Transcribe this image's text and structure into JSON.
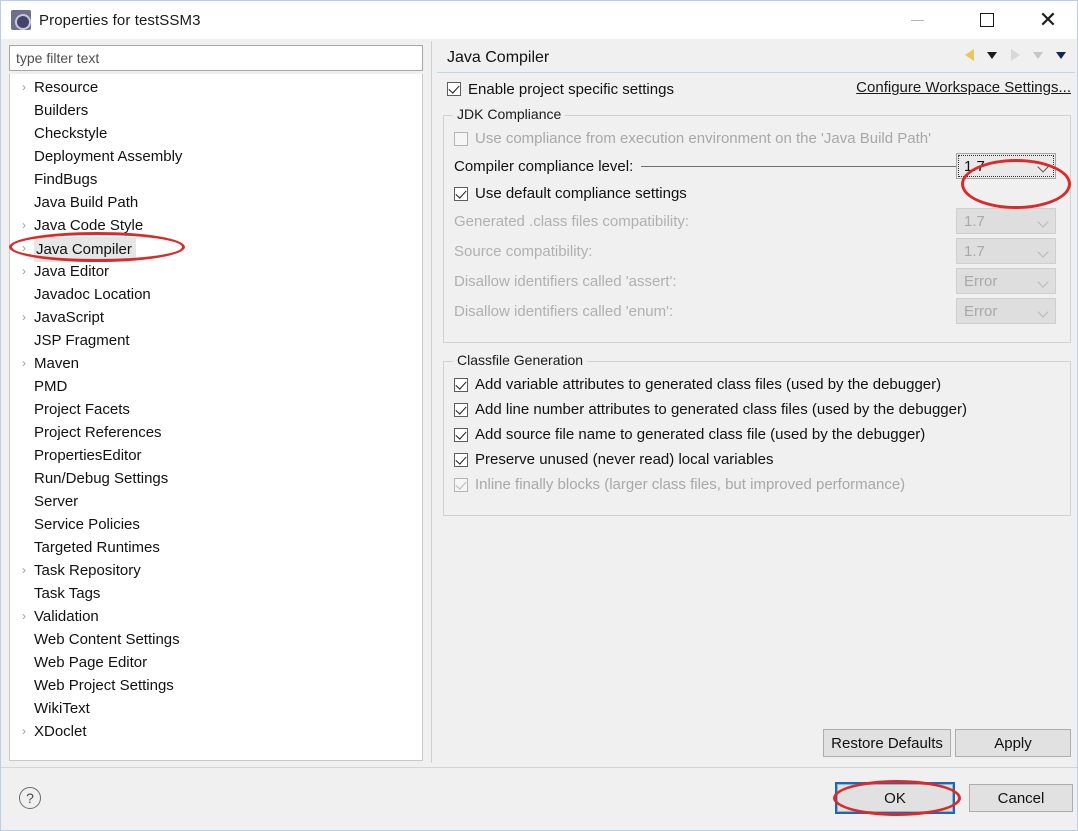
{
  "window": {
    "title": "Properties for testSSM3",
    "icon": "eclipse-gear-icon",
    "minimize_label": "Minimize",
    "maximize_label": "Maximize",
    "close_label": "Close"
  },
  "filter": {
    "placeholder": "type filter text",
    "value": ""
  },
  "tree": {
    "selected": "Java Compiler",
    "items": [
      {
        "label": "Resource",
        "expandable": true
      },
      {
        "label": "Builders",
        "expandable": false
      },
      {
        "label": "Checkstyle",
        "expandable": false
      },
      {
        "label": "Deployment Assembly",
        "expandable": false
      },
      {
        "label": "FindBugs",
        "expandable": false
      },
      {
        "label": "Java Build Path",
        "expandable": false
      },
      {
        "label": "Java Code Style",
        "expandable": true
      },
      {
        "label": "Java Compiler",
        "expandable": true
      },
      {
        "label": "Java Editor",
        "expandable": true
      },
      {
        "label": "Javadoc Location",
        "expandable": false
      },
      {
        "label": "JavaScript",
        "expandable": true
      },
      {
        "label": "JSP Fragment",
        "expandable": false
      },
      {
        "label": "Maven",
        "expandable": true
      },
      {
        "label": "PMD",
        "expandable": false
      },
      {
        "label": "Project Facets",
        "expandable": false
      },
      {
        "label": "Project References",
        "expandable": false
      },
      {
        "label": "PropertiesEditor",
        "expandable": false
      },
      {
        "label": "Run/Debug Settings",
        "expandable": false
      },
      {
        "label": "Server",
        "expandable": false
      },
      {
        "label": "Service Policies",
        "expandable": false
      },
      {
        "label": "Targeted Runtimes",
        "expandable": false
      },
      {
        "label": "Task Repository",
        "expandable": true
      },
      {
        "label": "Task Tags",
        "expandable": false
      },
      {
        "label": "Validation",
        "expandable": true
      },
      {
        "label": "Web Content Settings",
        "expandable": false
      },
      {
        "label": "Web Page Editor",
        "expandable": false
      },
      {
        "label": "Web Project Settings",
        "expandable": false
      },
      {
        "label": "WikiText",
        "expandable": false
      },
      {
        "label": "XDoclet",
        "expandable": true
      }
    ]
  },
  "page": {
    "title": "Java Compiler",
    "nav": {
      "back_icon": "back-arrow-icon",
      "back_menu_icon": "chevron-down-icon",
      "forward_icon": "forward-arrow-icon",
      "forward_menu_icon": "chevron-down-icon",
      "view_menu_icon": "chevron-down-icon"
    },
    "enable_project_specific": {
      "label": "Enable project specific settings",
      "checked": true
    },
    "configure_workspace_link": "Configure Workspace Settings...",
    "jdk_compliance": {
      "title": "JDK Compliance",
      "use_execution_environment": {
        "label": "Use compliance from execution environment on the 'Java Build Path'",
        "checked": false,
        "enabled": false
      },
      "compiler_compliance_level": {
        "label": "Compiler compliance level:",
        "value": "1.7",
        "focused": true
      },
      "use_default_compliance": {
        "label": "Use default compliance settings",
        "checked": true
      },
      "rows": [
        {
          "label": "Generated .class files compatibility:",
          "value": "1.7",
          "enabled": false
        },
        {
          "label": "Source compatibility:",
          "value": "1.7",
          "enabled": false
        },
        {
          "label": "Disallow identifiers called 'assert':",
          "value": "Error",
          "enabled": false
        },
        {
          "label": "Disallow identifiers called 'enum':",
          "value": "Error",
          "enabled": false
        }
      ]
    },
    "classfile_generation": {
      "title": "Classfile Generation",
      "options": [
        {
          "label": "Add variable attributes to generated class files (used by the debugger)",
          "checked": true,
          "enabled": true
        },
        {
          "label": "Add line number attributes to generated class files (used by the debugger)",
          "checked": true,
          "enabled": true
        },
        {
          "label": "Add source file name to generated class file (used by the debugger)",
          "checked": true,
          "enabled": true
        },
        {
          "label": "Preserve unused (never read) local variables",
          "checked": true,
          "enabled": true
        },
        {
          "label": "Inline finally blocks (larger class files, but improved performance)",
          "checked": true,
          "enabled": false
        }
      ]
    },
    "restore_defaults_label": "Restore Defaults",
    "apply_label": "Apply"
  },
  "footer": {
    "help_icon": "question-mark-icon",
    "ok_label": "OK",
    "cancel_label": "Cancel"
  },
  "annotations": {
    "color": "#d92b2b",
    "marks": [
      {
        "target": "tree-item-java-compiler",
        "shape": "ellipse"
      },
      {
        "target": "compiler-compliance-level-combo",
        "shape": "ellipse"
      },
      {
        "target": "ok-button",
        "shape": "ellipse"
      }
    ]
  }
}
